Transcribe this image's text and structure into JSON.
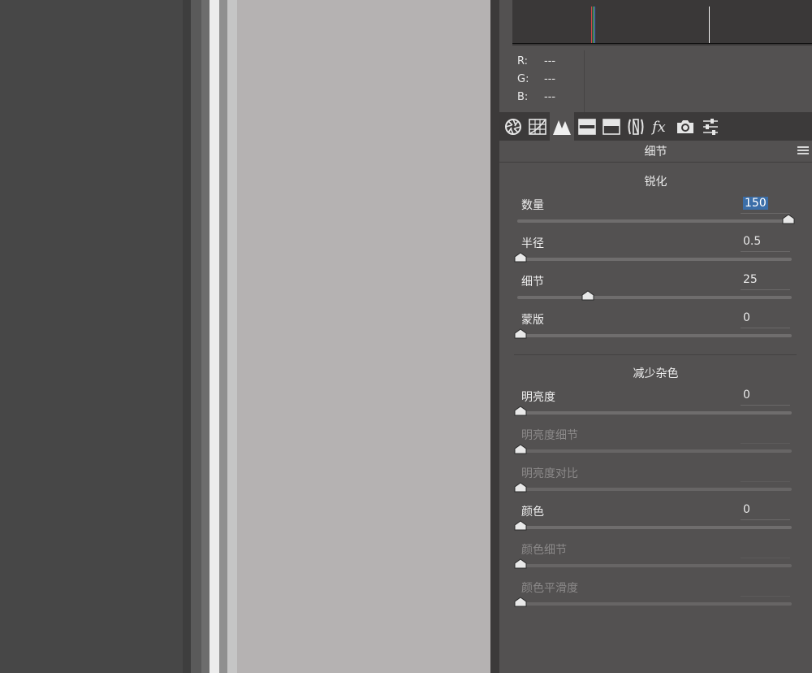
{
  "readout": {
    "r_label": "R:",
    "r_value": "---",
    "g_label": "G:",
    "g_value": "---",
    "b_label": "B:",
    "b_value": "---"
  },
  "tabs": [
    {
      "name": "basic-aperture-icon",
      "active": false
    },
    {
      "name": "tone-curve-grid-icon",
      "active": false
    },
    {
      "name": "detail-mountain-icon",
      "active": true
    },
    {
      "name": "hsl-icon",
      "active": false
    },
    {
      "name": "split-toning-icon",
      "active": false
    },
    {
      "name": "lens-correction-icon",
      "active": false
    },
    {
      "name": "fx-effects-icon",
      "active": false
    },
    {
      "name": "camera-calibration-icon",
      "active": false
    },
    {
      "name": "presets-sliders-icon",
      "active": false
    }
  ],
  "panel_title": "细节",
  "sharpen": {
    "heading": "锐化",
    "amount": {
      "label": "数量",
      "value": "150",
      "level": 1.0
    },
    "radius": {
      "label": "半径",
      "value": "0.5",
      "level": 0.0
    },
    "detail": {
      "label": "细节",
      "value": "25",
      "level": 0.25
    },
    "masking": {
      "label": "蒙版",
      "value": "0",
      "level": 0.0
    }
  },
  "noise": {
    "heading": "减少杂色",
    "luminance": {
      "label": "明亮度",
      "value": "0",
      "level": 0.0
    },
    "luminance_detail": {
      "label": "明亮度细节",
      "value": "",
      "level": 0.0
    },
    "luminance_contrast": {
      "label": "明亮度对比",
      "value": "",
      "level": 0.0
    },
    "color": {
      "label": "颜色",
      "value": "0",
      "level": 0.0
    },
    "color_detail": {
      "label": "颜色细节",
      "value": "",
      "level": 0.0
    },
    "color_smoothness": {
      "label": "颜色平滑度",
      "value": "",
      "level": 0.0
    }
  },
  "colors": {
    "selection": "#3b6ea8",
    "panel": "#535151",
    "toolbar": "#3c3a3a"
  }
}
